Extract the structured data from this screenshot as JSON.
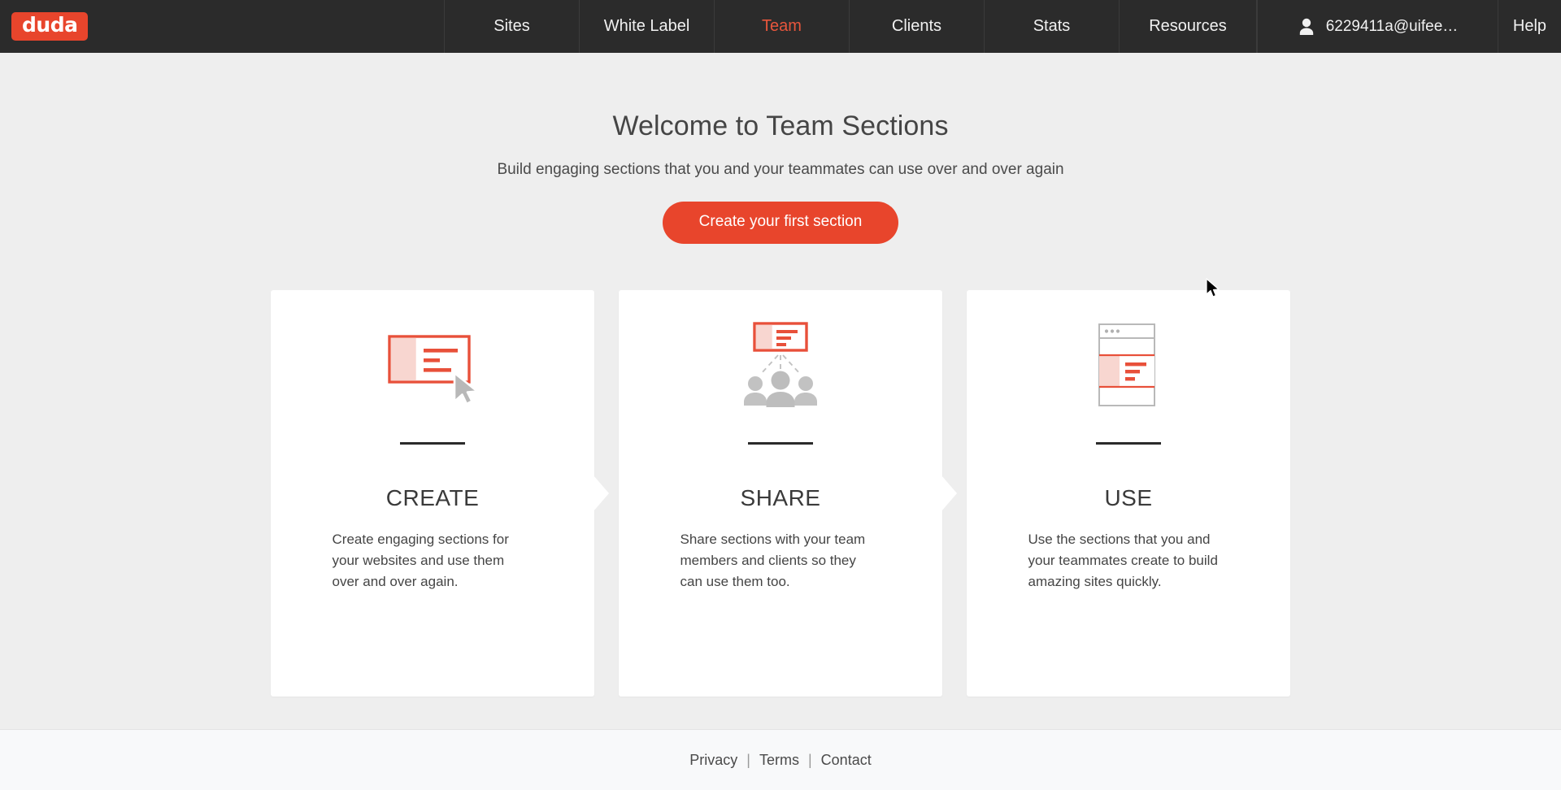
{
  "header": {
    "logo_text": "duda",
    "logo_color": "#e8452c",
    "background": "#2b2b2b",
    "nav": [
      {
        "label": "Sites",
        "active": false
      },
      {
        "label": "White Label",
        "active": false
      },
      {
        "label": "Team",
        "active": true
      },
      {
        "label": "Clients",
        "active": false
      },
      {
        "label": "Stats",
        "active": false
      },
      {
        "label": "Resources",
        "active": false
      }
    ],
    "account": {
      "icon": "person-icon",
      "email": "6229411a@uifee…"
    },
    "help_label": "Help"
  },
  "main": {
    "title": "Welcome to Team Sections",
    "subtitle": "Build engaging sections that you and your teammates can use over and over again",
    "cta_label": "Create your first section",
    "cta_color": "#e8452c",
    "background": "#eeeeee",
    "cards": [
      {
        "icon": "create-section-icon",
        "title": "CREATE",
        "text": "Create engaging sections for your websites and use them over and over again."
      },
      {
        "icon": "share-section-icon",
        "title": "SHARE",
        "text": "Share sections with your team members and clients so they can use them too."
      },
      {
        "icon": "use-section-icon",
        "title": "USE",
        "text": "Use the sections that you and your teammates create to build amazing sites quickly."
      }
    ]
  },
  "footer": {
    "background": "#f8f9fa",
    "links": [
      {
        "label": "Privacy"
      },
      {
        "label": "Terms"
      },
      {
        "label": "Contact"
      }
    ],
    "separator": "|"
  }
}
